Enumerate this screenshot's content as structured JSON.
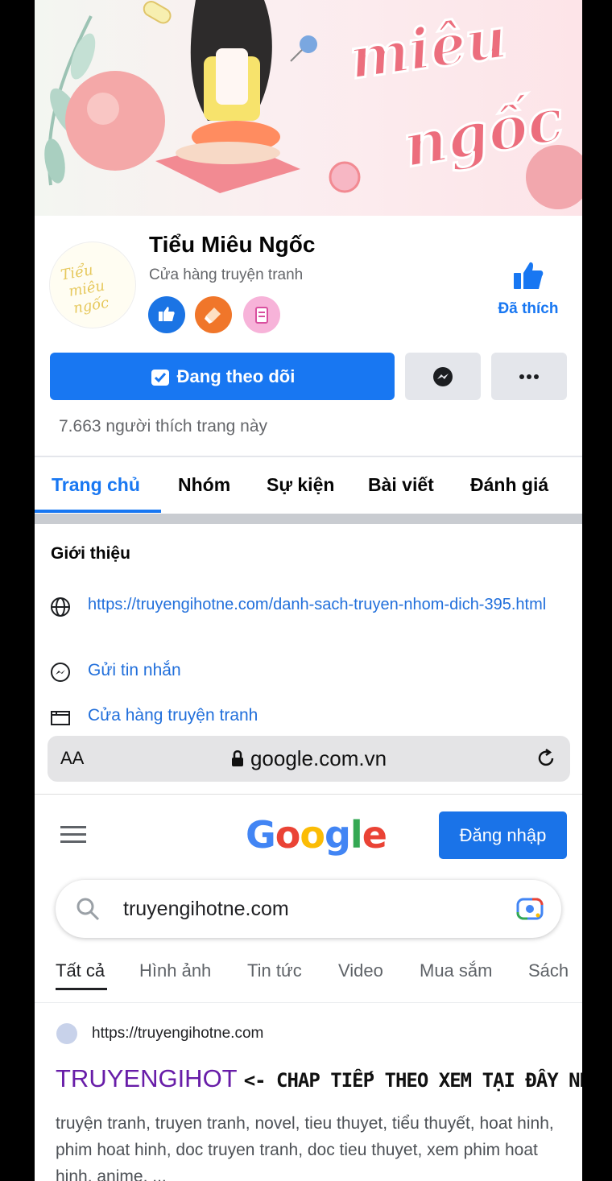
{
  "page": {
    "name": "Tiểu Miêu Ngốc",
    "category": "Cửa hàng truyện tranh",
    "liked_label": "Đã thích",
    "follow_button": "Đang theo dõi",
    "likes_count": "7.663 người thích trang này",
    "cover_icon": "illustrated-cover-art",
    "avatar_icon": "logo-lettering",
    "badges": [
      "like-badge-icon",
      "shop-badge-icon",
      "list-badge-icon"
    ]
  },
  "tabs": [
    {
      "label": "Trang chủ",
      "active": true
    },
    {
      "label": "Nhóm"
    },
    {
      "label": "Sự kiện"
    },
    {
      "label": "Bài viết"
    },
    {
      "label": "Đánh giá"
    }
  ],
  "intro": {
    "title": "Giới thiệu",
    "items": [
      {
        "icon": "globe-icon",
        "text": "https://truyengihotne.com/danh-sach-truyen-nhom-dich-395.html"
      },
      {
        "icon": "messenger-icon",
        "text": "Gửi tin nhắn"
      },
      {
        "icon": "shop-icon",
        "text": "Cửa hàng truyện tranh"
      }
    ]
  },
  "browser": {
    "aa_label": "AA",
    "url": "google.com.vn"
  },
  "google": {
    "logo": "Google",
    "sign_in": "Đăng nhập",
    "query": "truyengihotne.com",
    "tabs": [
      {
        "label": "Tất cả",
        "active": true
      },
      {
        "label": "Hình ảnh"
      },
      {
        "label": "Tin tức"
      },
      {
        "label": "Video"
      },
      {
        "label": "Mua sắm"
      },
      {
        "label": "Sách"
      }
    ],
    "result": {
      "url": "https://truyengihotne.com",
      "title": "TRUYENGIHOT",
      "overlay": "<- CHAP TIẾP THEO XEM TẠI ĐÂY NHA",
      "snippet": "truyện tranh, truyen tranh, novel, tieu thuyet, tiểu thuyết, hoat hinh, phim hoat hinh, doc truyen tranh, doc tieu thuyet, xem phim hoat hinh, anime, ..."
    }
  },
  "colors": {
    "facebook_blue": "#1877f2",
    "link_blue": "#216fdb",
    "google_blue": "#1a73e8",
    "result_title_purple": "#681da8"
  }
}
